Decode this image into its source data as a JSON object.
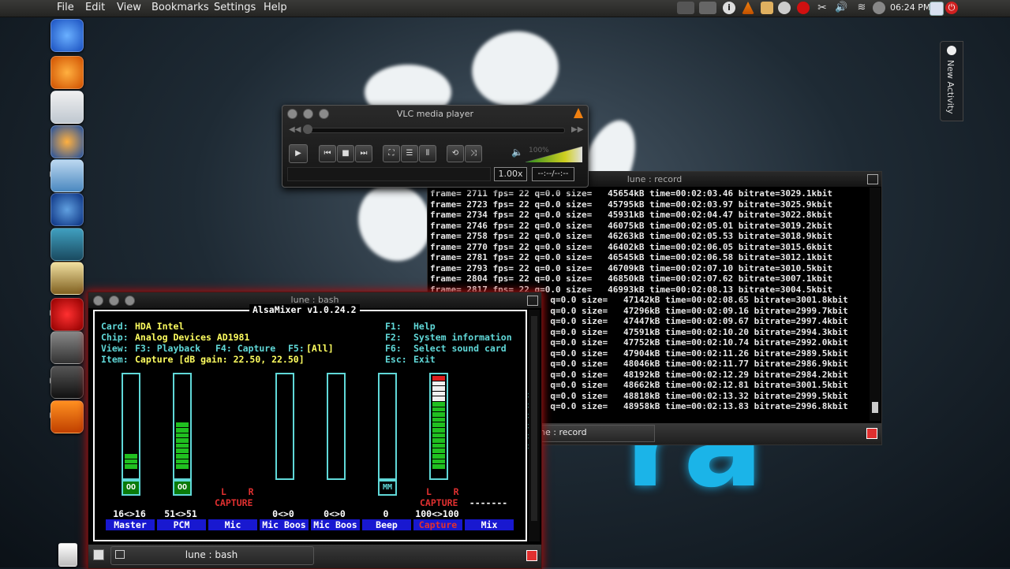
{
  "menubar": {
    "items": [
      "File",
      "Edit",
      "View",
      "Bookmarks",
      "Settings",
      "Help"
    ]
  },
  "tray": {
    "clock": "06:24 PM",
    "icons": [
      "network-indicator-icon",
      "info-icon",
      "vlc-icon",
      "folder-icon",
      "kmail-icon",
      "opera-icon",
      "scissors-icon",
      "volume-icon",
      "wifi-icon",
      "monitor-icon",
      "power-icon"
    ]
  },
  "launcher": {
    "icons": [
      "dolphin-icon",
      "blender-icon",
      "kwrite-icon",
      "firefox-icon",
      "file-manager-icon",
      "thunderbird-icon",
      "tv-icon",
      "notes-icon",
      "opera-icon",
      "kde-icon",
      "konsole-icon",
      "vlc-icon",
      "trash-icon"
    ]
  },
  "activity": {
    "label": "New Activity"
  },
  "wallpaper": {
    "text": "ra"
  },
  "vlc": {
    "title": "VLC media player",
    "speed": "1.00x",
    "time": "--:--/--:--",
    "volume": "100%",
    "volume_level": 1.0
  },
  "record": {
    "title": "lune : record",
    "tab_label": "ne : record",
    "lines": [
      "frame= 2711 fps= 22 q=0.0 size=   45654kB time=00:02:03.46 bitrate=3029.1kbit",
      "frame= 2723 fps= 22 q=0.0 size=   45795kB time=00:02:03.97 bitrate=3025.9kbit",
      "frame= 2734 fps= 22 q=0.0 size=   45931kB time=00:02:04.47 bitrate=3022.8kbit",
      "frame= 2746 fps= 22 q=0.0 size=   46075kB time=00:02:05.01 bitrate=3019.2kbit",
      "frame= 2758 fps= 22 q=0.0 size=   46263kB time=00:02:05.53 bitrate=3018.9kbit",
      "frame= 2770 fps= 22 q=0.0 size=   46402kB time=00:02:06.05 bitrate=3015.6kbit",
      "frame= 2781 fps= 22 q=0.0 size=   46545kB time=00:02:06.58 bitrate=3012.1kbit",
      "frame= 2793 fps= 22 q=0.0 size=   46709kB time=00:02:07.10 bitrate=3010.5kbit",
      "frame= 2804 fps= 22 q=0.0 size=   46850kB time=00:02:07.62 bitrate=3007.1kbit",
      "frame= 2817 fps= 22 q=0.0 size=   46993kB time=00:02:08.13 bitrate=3004.5kbit",
      "                       q=0.0 size=   47142kB time=00:02:08.65 bitrate=3001.8kbit",
      "                       q=0.0 size=   47296kB time=00:02:09.16 bitrate=2999.7kbit",
      "                       q=0.0 size=   47447kB time=00:02:09.67 bitrate=2997.4kbit",
      "                       q=0.0 size=   47591kB time=00:02:10.20 bitrate=2994.3kbit",
      "                       q=0.0 size=   47752kB time=00:02:10.74 bitrate=2992.0kbit",
      "                       q=0.0 size=   47904kB time=00:02:11.26 bitrate=2989.5kbit",
      "                       q=0.0 size=   48046kB time=00:02:11.77 bitrate=2986.9kbit",
      "                       q=0.0 size=   48192kB time=00:02:12.29 bitrate=2984.2kbit",
      "                       q=0.0 size=   48662kB time=00:02:12.81 bitrate=3001.5kbit",
      "                       q=0.0 size=   48818kB time=00:02:13.32 bitrate=2999.5kbit",
      "                       q=0.0 size=   48958kB time=00:02:13.83 bitrate=2996.8kbit"
    ]
  },
  "bash": {
    "title": "lune : bash",
    "tab_label": "lune : bash",
    "mixer": {
      "header": "AlsaMixer v1.0.24.2",
      "card_label": "Card:",
      "card_value": "HDA Intel",
      "chip_label": "Chip:",
      "chip_value": "Analog Devices AD1981",
      "view_label": "View:",
      "view_playback": "F3: Playback",
      "view_capture": "F4: Capture",
      "view_all_key": "F5:",
      "view_all": "[All]",
      "item_label": "Item:",
      "item_value": "Capture [dB gain: 22.50, 22.50]",
      "help": [
        {
          "key": "F1:",
          "text": "Help"
        },
        {
          "key": "F2:",
          "text": "System information"
        },
        {
          "key": "F6:",
          "text": "Select sound card"
        },
        {
          "key": "Esc:",
          "text": "Exit"
        }
      ],
      "channels": [
        {
          "name": "Master",
          "value": "16<>16",
          "level": 0.16,
          "switch": "OO",
          "capture": false
        },
        {
          "name": "PCM",
          "value": "51<>51",
          "level": 0.51,
          "switch": "OO",
          "capture": false
        },
        {
          "name": "Mic",
          "value": "",
          "level": null,
          "switch": "",
          "capture": true,
          "lr": "L    R",
          "cap_label": "CAPTURE"
        },
        {
          "name": "Mic Boos",
          "value": "0<>0",
          "level": 0.0,
          "switch": "",
          "capture": false
        },
        {
          "name": "Mic Boos",
          "value": "0<>0",
          "level": 0.0,
          "switch": "",
          "capture": false
        },
        {
          "name": "Beep",
          "value": "0",
          "level": 0.0,
          "switch": "MM",
          "capture": false
        },
        {
          "name": "Capture",
          "value": "100<>100",
          "level": 1.0,
          "switch": "",
          "capture": true,
          "lr": "L    R",
          "cap_label": "CAPTURE",
          "selected": true
        },
        {
          "name": "Mix",
          "value": "-------",
          "level": null,
          "switch": "",
          "capture": false
        }
      ],
      "more_arrow": ">"
    }
  }
}
